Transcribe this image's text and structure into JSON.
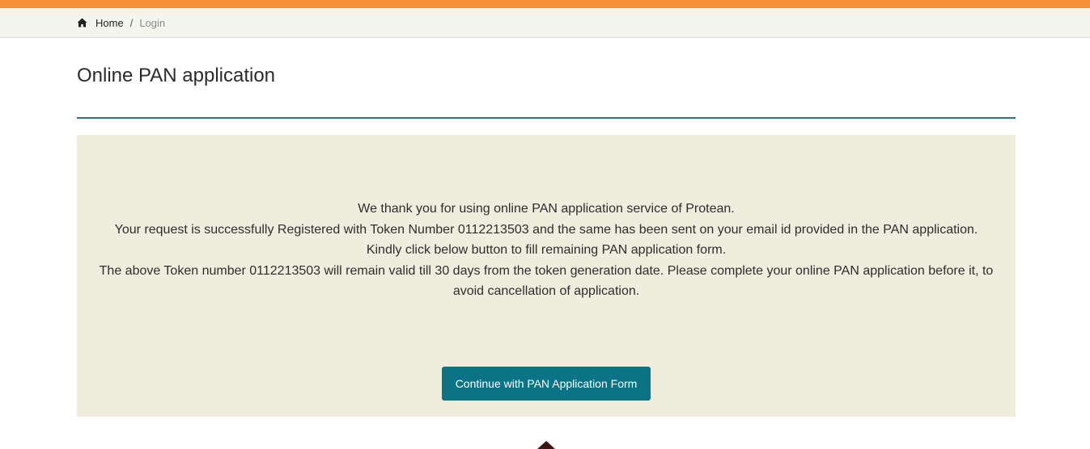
{
  "breadcrumb": {
    "home_label": "Home",
    "separator": "/",
    "current_label": "Login"
  },
  "page": {
    "title": "Online PAN application"
  },
  "message": {
    "line1": "We thank you for using online PAN application service of Protean.",
    "line2": "Your request is successfully Registered with Token Number 0112213503 and the same has been sent on your email id provided in the PAN application.",
    "line3": "Kindly click below button to fill remaining PAN application form.",
    "line4": "The above Token number 0112213503 will remain valid till 30 days from the token generation date. Please complete your online PAN application before it, to avoid cancellation of application."
  },
  "actions": {
    "continue_label": "Continue with PAN Application Form"
  },
  "icons": {
    "home": "home-icon",
    "scroll_top": "chevron-up-icon"
  },
  "colors": {
    "top_strip": "#f7923a",
    "accent_rule": "#1d7c8c",
    "panel_background": "#efeddd",
    "button_background": "#0a7385"
  }
}
